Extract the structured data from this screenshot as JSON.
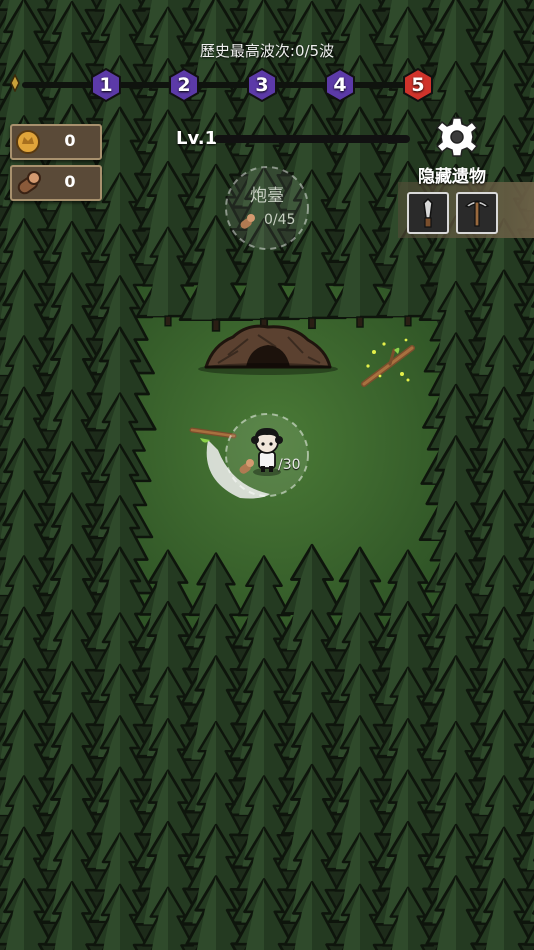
{
  "hud": {
    "wave_record": "歷史最高波次:0/5波",
    "waves": [
      {
        "label": "1",
        "color": "#5c3aa8"
      },
      {
        "label": "2",
        "color": "#5c3aa8"
      },
      {
        "label": "3",
        "color": "#5c3aa8"
      },
      {
        "label": "4",
        "color": "#5c3aa8"
      },
      {
        "label": "5",
        "color": "#d0332b"
      }
    ],
    "wave_start_icon": "flag-icon",
    "level_label": "Lv.1",
    "level_progress": 0
  },
  "resources": [
    {
      "name": "gold",
      "icon": "gold-coin-icon",
      "value": "0"
    },
    {
      "name": "wood",
      "icon": "wood-log-icon",
      "value": "0"
    }
  ],
  "relics": {
    "title": "隐藏遗物",
    "items": [
      {
        "icon": "knife-icon"
      },
      {
        "icon": "pickaxe-icon"
      }
    ]
  },
  "build_spot": {
    "label": "炮臺",
    "cost": "0/45",
    "icon": "wood-log-icon"
  },
  "player": {
    "cost": "/30",
    "icon": "wood-log-icon"
  },
  "colors": {
    "grass": "#3e6b2f",
    "tree_dark": "#1c2d1a",
    "tree_light": "#2f4a2b",
    "panel": "#5a4a38",
    "wave_purple": "#5c3aa8",
    "wave_red": "#d0332b"
  }
}
